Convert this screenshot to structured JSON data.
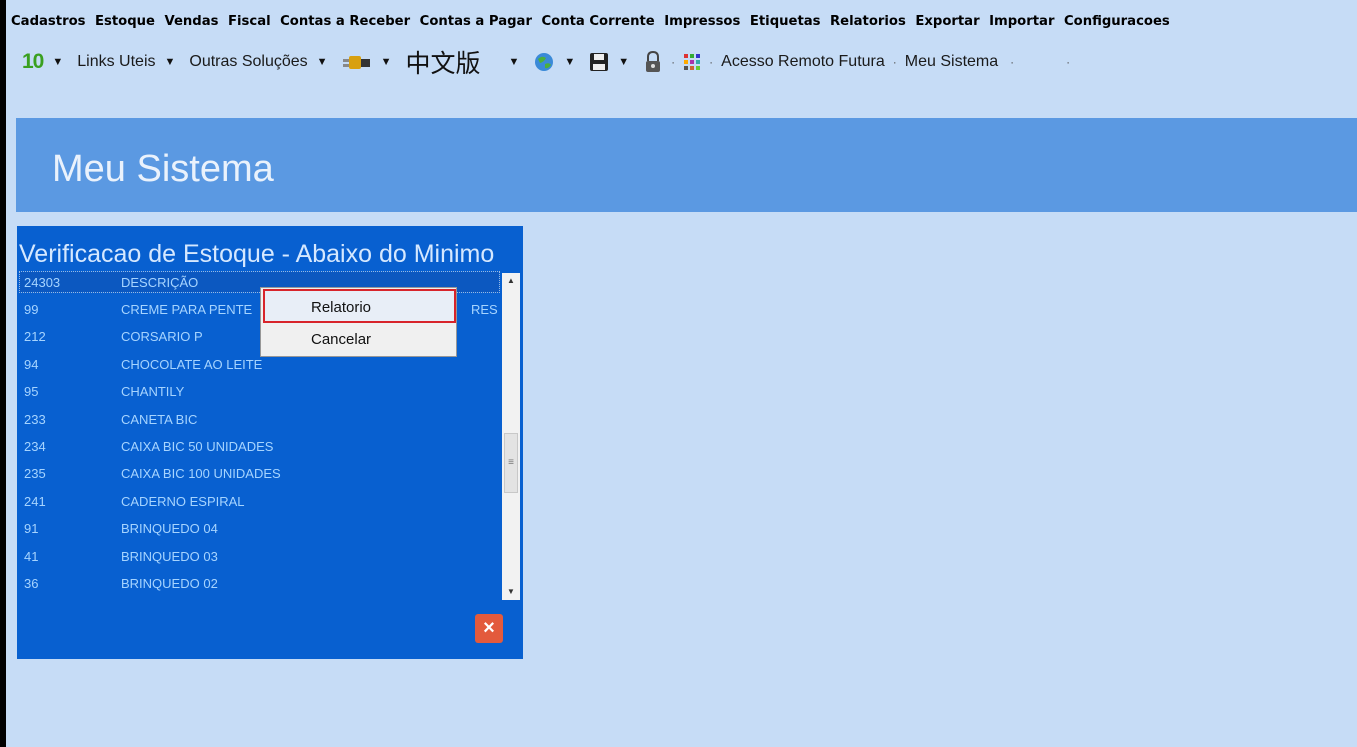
{
  "menubar": {
    "items": [
      "Cadastros",
      "Estoque",
      "Vendas",
      "Fiscal",
      "Contas a Receber",
      "Contas a Pagar",
      "Conta Corrente",
      "Impressos",
      "Etiquetas",
      "Relatorios",
      "Exportar",
      "Importar",
      "Configuracoes"
    ]
  },
  "toolbar": {
    "version_label": "10",
    "links_uteis": "Links Uteis",
    "outras_solucoes": "Outras Soluções",
    "chinese_version": "中文版",
    "acesso_remoto": "Acesso Remoto Futura",
    "meu_sistema": "Meu Sistema",
    "separator": "·"
  },
  "banner": {
    "title": "Meu Sistema"
  },
  "panel": {
    "title": "Verificacao de Estoque - Abaixo do Minimo",
    "rows": [
      {
        "code": "24303",
        "desc": "DESCRIÇÃO"
      },
      {
        "code": "99",
        "desc": "CREME PARA PENTE",
        "desc_ext": "RES"
      },
      {
        "code": "212",
        "desc": "CORSARIO P"
      },
      {
        "code": "94",
        "desc": "CHOCOLATE AO LEITE"
      },
      {
        "code": "95",
        "desc": "CHANTILY"
      },
      {
        "code": "233",
        "desc": "CANETA BIC"
      },
      {
        "code": "234",
        "desc": "CAIXA BIC 50 UNIDADES"
      },
      {
        "code": "235",
        "desc": "CAIXA BIC 100 UNIDADES"
      },
      {
        "code": "241",
        "desc": "CADERNO ESPIRAL"
      },
      {
        "code": "91",
        "desc": "BRINQUEDO 04"
      },
      {
        "code": "41",
        "desc": "BRINQUEDO 03"
      },
      {
        "code": "36",
        "desc": "BRINQUEDO 02"
      }
    ],
    "close_label": "×"
  },
  "context_menu": {
    "items": [
      "Relatorio",
      "Cancelar"
    ]
  },
  "colors": {
    "background": "#c6dcf6",
    "banner": "#5b99e2",
    "panel": "#0860d0",
    "list_text": "#a6d4ff",
    "close_button": "#e35a3c",
    "highlight_border": "#d8242a"
  }
}
